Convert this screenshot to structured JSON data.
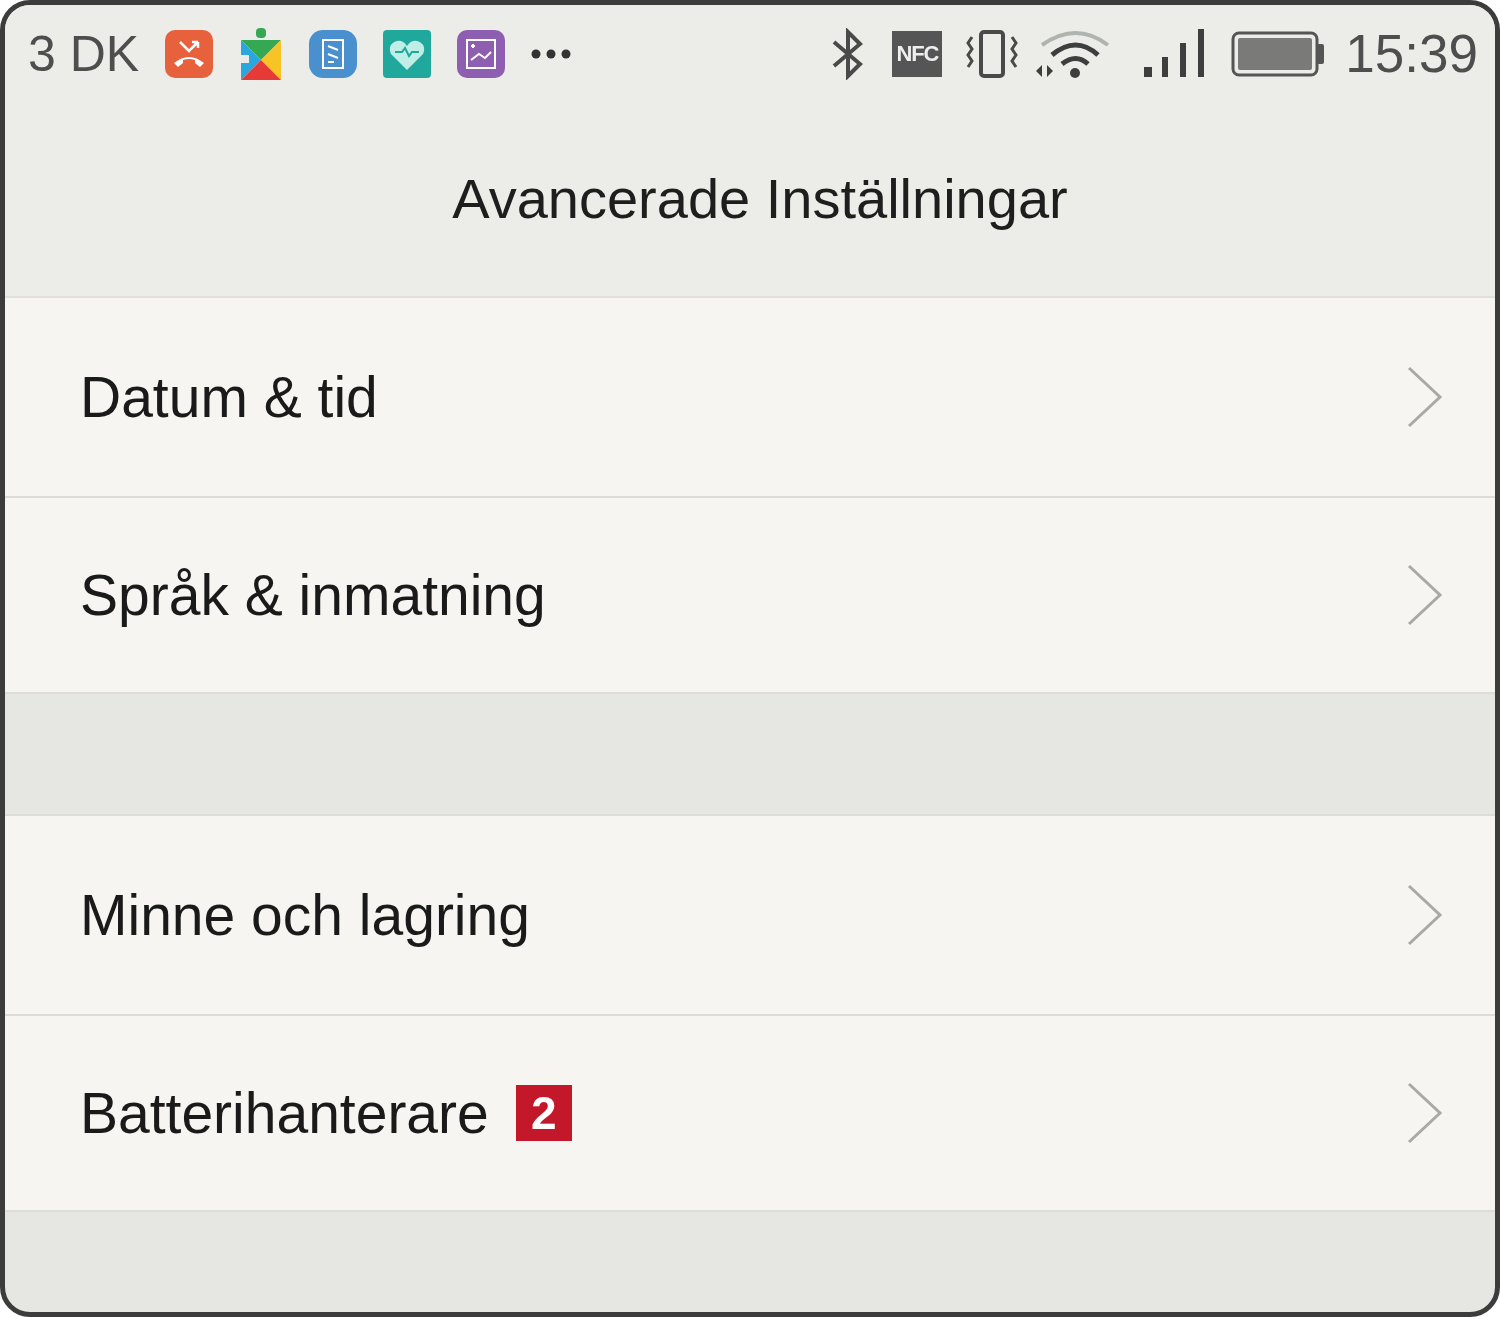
{
  "status_bar": {
    "carrier": "3 DK",
    "notification_icons": [
      {
        "kind": "missed-call",
        "color": "#e8613d"
      },
      {
        "kind": "puzzle",
        "color": "#34a853"
      },
      {
        "kind": "document",
        "color": "#4a8fce"
      },
      {
        "kind": "health",
        "color": "#21a89c"
      },
      {
        "kind": "chart",
        "color": "#8e5fb0"
      }
    ],
    "nfc": "NFC",
    "time": "15:39"
  },
  "header": {
    "title": "Avancerade Inställningar"
  },
  "sections": [
    {
      "items": [
        {
          "label": "Datum & tid"
        },
        {
          "label": "Språk & inmatning"
        }
      ]
    },
    {
      "items": [
        {
          "label": "Minne och lagring"
        },
        {
          "label": "Batterihanterare",
          "badge": "2"
        }
      ]
    }
  ]
}
